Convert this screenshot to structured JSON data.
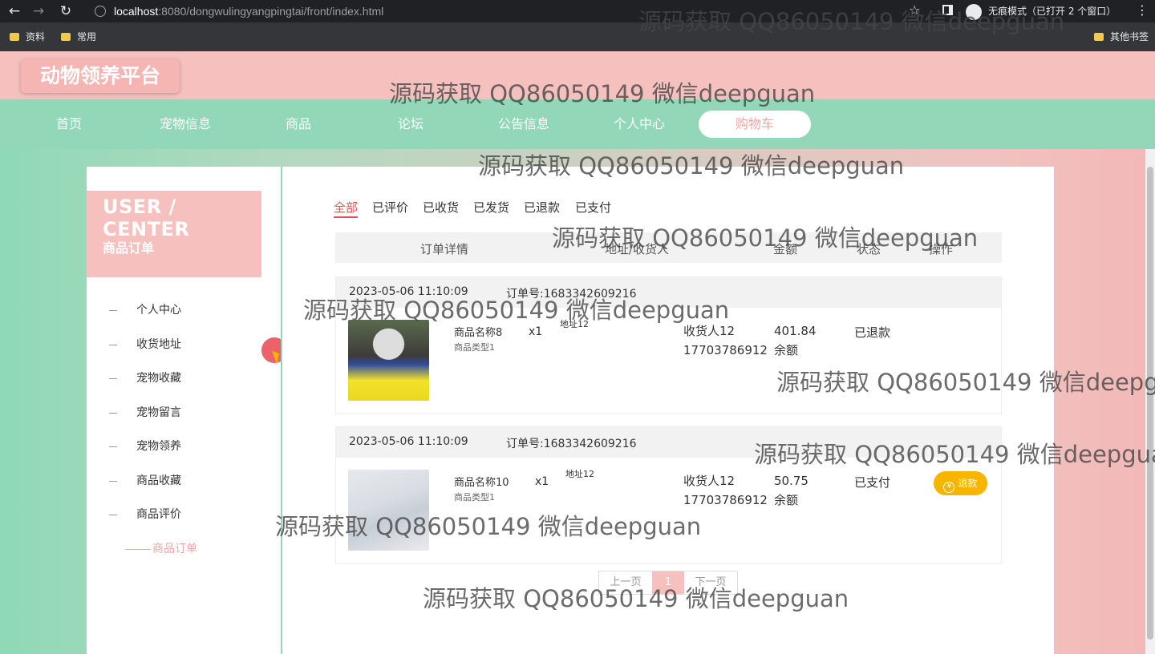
{
  "browser": {
    "url_host": "localhost",
    "url_path": ":8080/dongwulingyangpingtai/front/index.html",
    "incognito_label": "无痕模式（已打开 2 个窗口）",
    "bookmarks": [
      "资料",
      "常用"
    ],
    "other_bookmarks": "其他书签"
  },
  "site": {
    "logo": "动物领养平台",
    "nav": [
      "首页",
      "宠物信息",
      "商品",
      "论坛",
      "公告信息",
      "个人中心",
      "购物车"
    ]
  },
  "sidebar": {
    "title": "USER / CENTER",
    "subtitle": "商品订单",
    "items": [
      "个人中心",
      "收货地址",
      "宠物收藏",
      "宠物留言",
      "宠物领养",
      "商品收藏",
      "商品评价",
      "商品订单"
    ]
  },
  "orders": {
    "tabs": [
      "全部",
      "已评价",
      "已收货",
      "已发货",
      "已退款",
      "已支付"
    ],
    "columns": [
      "订单详情",
      "地址/收货人",
      "金额",
      "状态",
      "操作"
    ],
    "rows": [
      {
        "time": "2023-05-06 11:10:09",
        "order_no": "订单号:1683342609216",
        "name": "商品名称8",
        "type": "商品类型1",
        "qty": "x1",
        "address": "地址12",
        "receiver": "收货人12",
        "phone": "17703786912",
        "amount": "401.84",
        "pay": "余额",
        "status": "已退款",
        "action": ""
      },
      {
        "time": "2023-05-06 11:10:09",
        "order_no": "订单号:1683342609216",
        "name": "商品名称10",
        "type": "商品类型1",
        "qty": "x1",
        "address": "地址12",
        "receiver": "收货人12",
        "phone": "17703786912",
        "amount": "50.75",
        "pay": "余额",
        "status": "已支付",
        "action": "退款"
      }
    ],
    "pager": {
      "prev": "上一页",
      "current": "1",
      "next": "下一页"
    }
  },
  "watermark": "源码获取 QQ86050149 微信deepguan",
  "colors": {
    "pink": "#f6c0be",
    "mint": "#92d8b8",
    "refund": "#f7b500",
    "active_tab": "#e0505a"
  }
}
